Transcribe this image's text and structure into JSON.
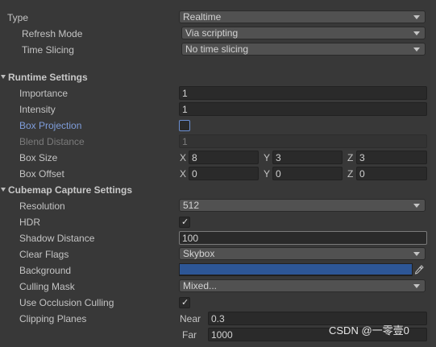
{
  "type": {
    "label": "Type",
    "value": "Realtime"
  },
  "refresh_mode": {
    "label": "Refresh Mode",
    "value": "Via scripting"
  },
  "time_slicing": {
    "label": "Time Slicing",
    "value": "No time slicing"
  },
  "runtime_settings": {
    "header": "Runtime Settings",
    "importance": {
      "label": "Importance",
      "value": "1"
    },
    "intensity": {
      "label": "Intensity",
      "value": "1"
    },
    "box_projection": {
      "label": "Box Projection"
    },
    "blend_distance": {
      "label": "Blend Distance",
      "value": "1"
    },
    "box_size": {
      "label": "Box Size",
      "x": "8",
      "y": "3",
      "z": "3"
    },
    "box_offset": {
      "label": "Box Offset",
      "x": "0",
      "y": "0",
      "z": "0"
    }
  },
  "cubemap_capture": {
    "header": "Cubemap Capture Settings",
    "resolution": {
      "label": "Resolution",
      "value": "512"
    },
    "hdr": {
      "label": "HDR",
      "checked": true
    },
    "shadow_distance": {
      "label": "Shadow Distance",
      "value": "100"
    },
    "clear_flags": {
      "label": "Clear Flags",
      "value": "Skybox"
    },
    "background": {
      "label": "Background",
      "color": "#2d5696"
    },
    "culling_mask": {
      "label": "Culling Mask",
      "value": "Mixed..."
    },
    "occlusion_culling": {
      "label": "Use Occlusion Culling",
      "checked": true
    },
    "clipping_planes": {
      "label": "Clipping Planes",
      "near_label": "Near",
      "near": "0.3",
      "far_label": "Far",
      "far": "1000"
    }
  },
  "axis_labels": {
    "x": "X",
    "y": "Y",
    "z": "Z"
  },
  "watermark": "CSDN @一零壹0",
  "icons": {
    "dropdown": "chevron-down-icon",
    "eyedropper": "eyedropper-icon",
    "check": "checkmark-icon"
  }
}
